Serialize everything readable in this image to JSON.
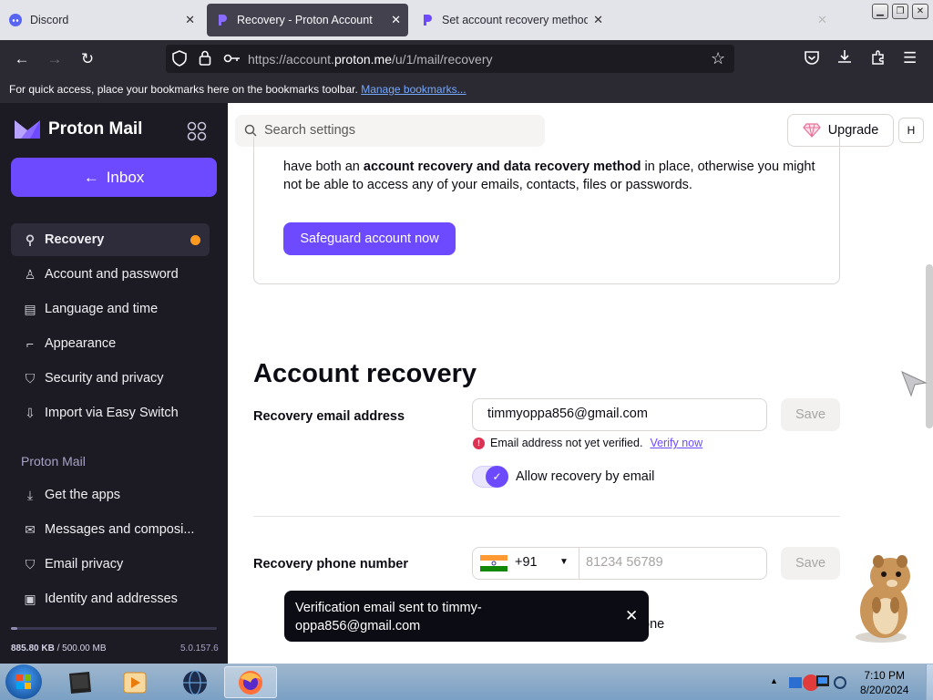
{
  "browser": {
    "tabs": [
      {
        "title": "Discord"
      },
      {
        "title": "Recovery - Proton Account"
      },
      {
        "title": "Set account recovery methods"
      }
    ],
    "url_prefix": "https://account.",
    "url_domain": "proton.me",
    "url_path": "/u/1/mail/recovery",
    "bookmarks_text": "For quick access, place your bookmarks here on the bookmarks toolbar.",
    "bookmarks_link": "Manage bookmarks..."
  },
  "sidebar": {
    "brand": "Proton Mail",
    "inbox_label": "Inbox",
    "items": [
      {
        "label": "Recovery",
        "icon": "key-icon"
      },
      {
        "label": "Account and password",
        "icon": "user-icon"
      },
      {
        "label": "Language and time",
        "icon": "language-icon"
      },
      {
        "label": "Appearance",
        "icon": "paint-roller-icon"
      },
      {
        "label": "Security and privacy",
        "icon": "shield-icon"
      },
      {
        "label": "Import via Easy Switch",
        "icon": "import-icon"
      }
    ],
    "section_title": "Proton Mail",
    "mail_items": [
      {
        "label": "Get the apps",
        "icon": "download-icon"
      },
      {
        "label": "Messages and composi...",
        "icon": "envelope-icon"
      },
      {
        "label": "Email privacy",
        "icon": "shield-icon"
      },
      {
        "label": "Identity and addresses",
        "icon": "id-card-icon"
      }
    ],
    "storage_used": "885.80 KB",
    "storage_total": "/ 500.00 MB",
    "storage_fraction": 0.002,
    "version": "5.0.157.6"
  },
  "header": {
    "search_placeholder": "Search settings",
    "upgrade_label": "Upgrade",
    "avatar_initial": "H"
  },
  "card": {
    "text_prefix": "have both an ",
    "text_bold": "account recovery and data recovery method",
    "text_suffix": " in place, otherwise you might not be able to access any of your emails, contacts, files or passwords.",
    "button_label": "Safeguard account now"
  },
  "account_recovery": {
    "heading": "Account recovery",
    "email_label": "Recovery email address",
    "email_value": "timmyoppa856@gmail.com",
    "save_label": "Save",
    "warning_text": "Email address not yet verified.",
    "verify_link": "Verify now",
    "allow_label": "Allow recovery by email",
    "phone_label": "Recovery phone number",
    "country_code": "+91",
    "phone_placeholder": "81234 56789",
    "phone_save_label": "Save",
    "partial_text": "one"
  },
  "toast": {
    "message": "Verification email sent to timmy-oppa856@gmail.com"
  },
  "taskbar": {
    "time": "7:10 PM",
    "date": "8/20/2024"
  },
  "colors": {
    "accent": "#6d4aff",
    "sidebar_bg": "#1c1b24",
    "notice_dot": "#ff9a1f"
  }
}
